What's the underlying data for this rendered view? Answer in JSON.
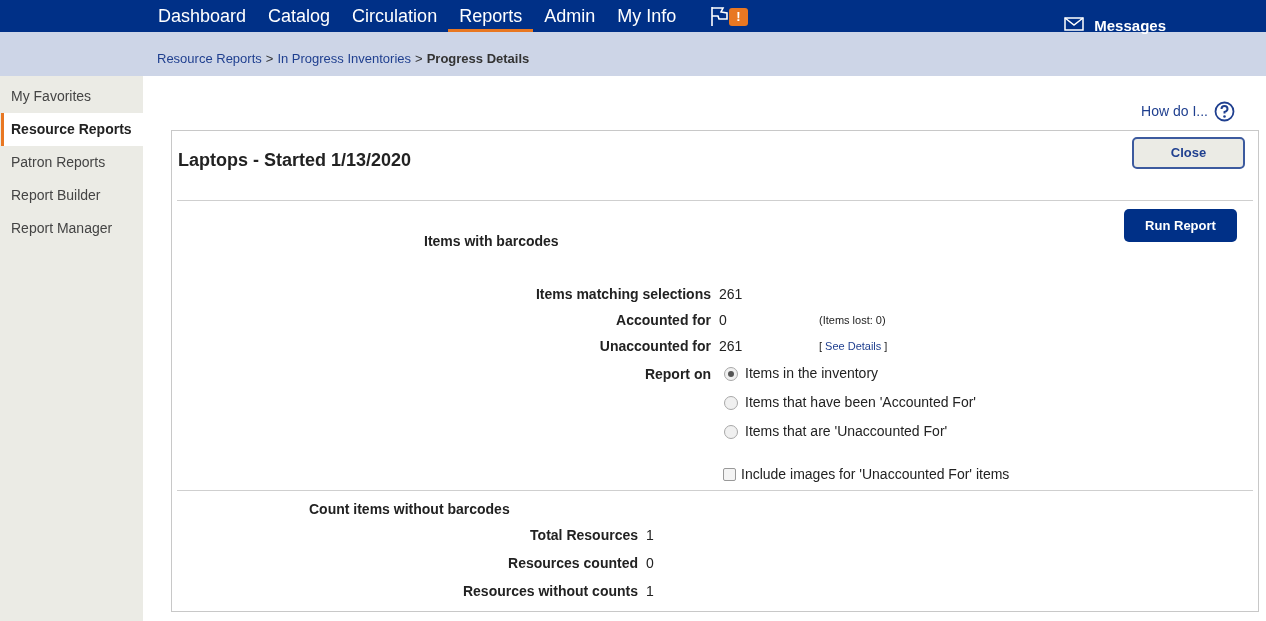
{
  "nav": {
    "tabs": [
      {
        "label": "Dashboard",
        "selected": false
      },
      {
        "label": "Catalog",
        "selected": false
      },
      {
        "label": "Circulation",
        "selected": false
      },
      {
        "label": "Reports",
        "selected": true
      },
      {
        "label": "Admin",
        "selected": false
      },
      {
        "label": "My Info",
        "selected": false
      }
    ],
    "alert_badge": "!",
    "messages": "Messages"
  },
  "breadcrumb": {
    "links": [
      "Resource Reports",
      "In Progress Inventories"
    ],
    "separator": ">",
    "current": "Progress Details"
  },
  "sidebar": {
    "items": [
      {
        "label": "My Favorites",
        "selected": false
      },
      {
        "label": "Resource Reports",
        "selected": true
      },
      {
        "label": "Patron Reports",
        "selected": false
      },
      {
        "label": "Report Builder",
        "selected": false
      },
      {
        "label": "Report Manager",
        "selected": false
      }
    ]
  },
  "help_link": "How do I...",
  "panel": {
    "title": "Laptops - Started 1/13/2020",
    "close_button": "Close",
    "run_button": "Run Report",
    "section_heading": "Items with barcodes",
    "stats": [
      {
        "label": "Items matching selections",
        "value": "261"
      },
      {
        "label": "Accounted for",
        "value": "0",
        "note": "(Items lost: 0)"
      },
      {
        "label": "Unaccounted for",
        "value": "261",
        "link_open": "[",
        "link": "See Details",
        "link_close": "]"
      }
    ],
    "report_on_label": "Report on",
    "report_options": [
      {
        "label": "Items in the inventory",
        "selected": true
      },
      {
        "label": "Items that have been 'Accounted For'",
        "selected": false
      },
      {
        "label": "Items that are 'Unaccounted For'",
        "selected": false
      }
    ],
    "include_images": {
      "label": "Include images for 'Unaccounted For' items",
      "checked": false
    },
    "count_heading": "Count items without barcodes",
    "counts": [
      {
        "label": "Total Resources",
        "value": "1"
      },
      {
        "label": "Resources counted",
        "value": "0"
      },
      {
        "label": "Resources without counts",
        "value": "1"
      }
    ]
  }
}
